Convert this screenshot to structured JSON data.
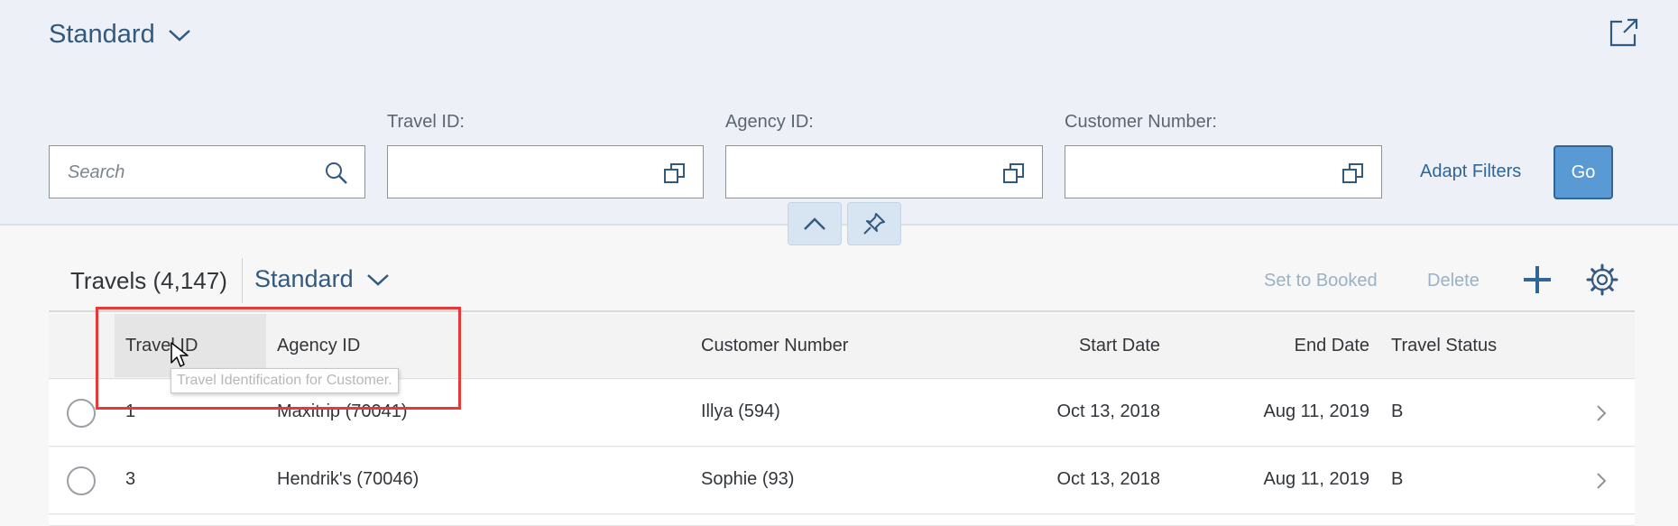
{
  "header": {
    "variant_label": "Standard",
    "search_placeholder": "Search",
    "filters": [
      {
        "label": "Travel ID:",
        "value": ""
      },
      {
        "label": "Agency ID:",
        "value": ""
      },
      {
        "label": "Customer Number:",
        "value": ""
      }
    ],
    "adapt_filters_label": "Adapt Filters",
    "go_label": "Go"
  },
  "table": {
    "title": "Travels (4,147)",
    "variant_label": "Standard",
    "actions": {
      "set_to_booked": "Set to Booked",
      "delete": "Delete"
    },
    "columns": [
      "Travel ID",
      "Agency ID",
      "Customer Number",
      "Start Date",
      "End Date",
      "Travel Status"
    ],
    "rows": [
      {
        "travel_id": "1",
        "agency": "Maxitrip (70041)",
        "customer": "Illya (594)",
        "start": "Oct 13, 2018",
        "end": "Aug 11, 2019",
        "status": "B"
      },
      {
        "travel_id": "3",
        "agency": "Hendrik's (70046)",
        "customer": "Sophie (93)",
        "start": "Oct 13, 2018",
        "end": "Aug 11, 2019",
        "status": "B"
      }
    ]
  },
  "tooltip": "Travel Identification for Customer.",
  "colors": {
    "accent": "#2f6597",
    "go_button": "#5a9ad4",
    "highlight": "#e83838",
    "header_bg": "#edf1f7"
  }
}
